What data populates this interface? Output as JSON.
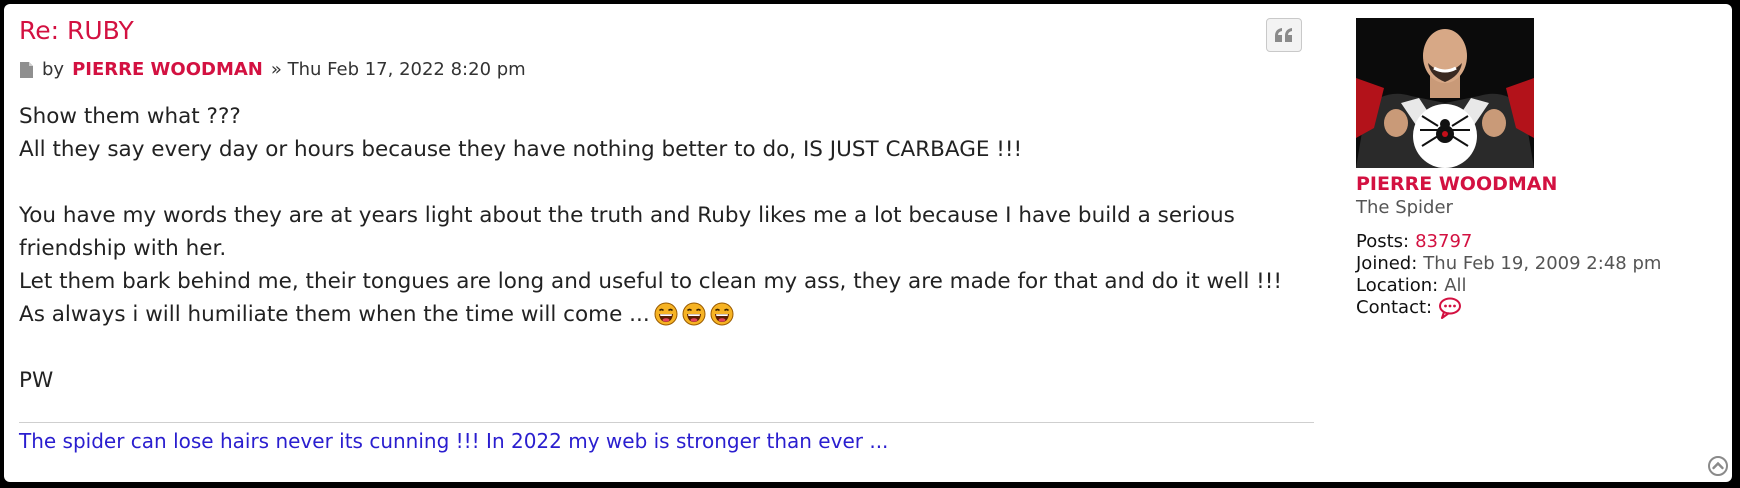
{
  "post": {
    "title": "Re: RUBY",
    "by_label": "by",
    "author": "PIERRE WOODMAN",
    "date": "» Thu Feb 17, 2022 8:20 pm",
    "lines": [
      "Show them what ???",
      "All they say every day or hours because they have nothing better to do, IS JUST CARBAGE !!!",
      "",
      "You have my words they are at years light about the truth and Ruby likes me a lot because I have build a serious",
      "friendship with her.",
      "Let them bark behind me, their tongues are long and useful to clean my ass, they are made for that and do it well !!!",
      "As always i will humiliate them when the time will come ...",
      "",
      "PW"
    ],
    "emoji_count": 3,
    "signature": "The spider can lose hairs never its cunning !!! In 2022 my web is stronger than ever ..."
  },
  "profile": {
    "name": "PIERRE WOODMAN",
    "rank": "The Spider",
    "posts_label": "Posts:",
    "posts_value": "83797",
    "joined_label": "Joined:",
    "joined_value": "Thu Feb 19, 2009 2:48 pm",
    "location_label": "Location:",
    "location_value": "All",
    "contact_label": "Contact:"
  },
  "icons": {
    "quote": "quote-icon",
    "post": "file-icon",
    "contact": "speech-bubble-icon",
    "back_to_top": "chevron-up-circle-icon"
  },
  "colors": {
    "accent": "#d31141",
    "signature": "#2a1ecf",
    "text": "#222222"
  }
}
